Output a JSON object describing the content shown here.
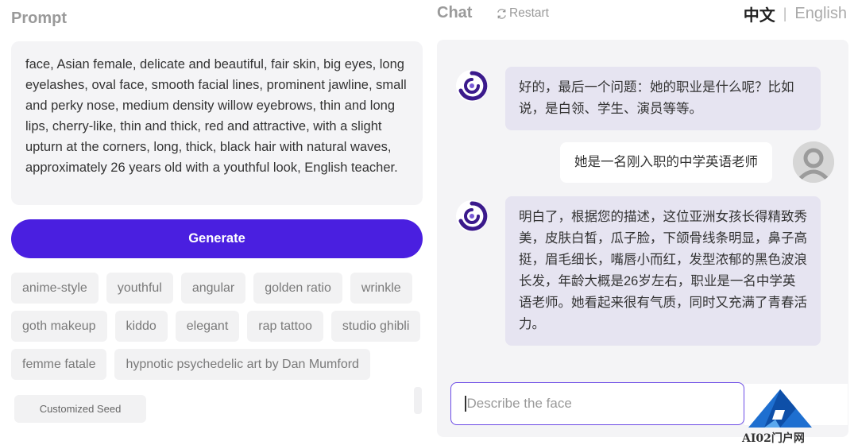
{
  "prompt": {
    "title": "Prompt",
    "text": "face, Asian female, delicate and beautiful, fair skin, big eyes, long eyelashes, oval face, smooth facial lines, prominent jawline, small and perky nose, medium density willow eyebrows, thin and long lips, cherry-like, thin and thick, red and attractive, with a slight upturn at the corners, long, thick, black hair with natural waves, approximately 26 years old with a youthful look, English teacher."
  },
  "generate_label": "Generate",
  "tags": [
    [
      "anime-style",
      "youthful",
      "angular",
      "golden ratio",
      "wrinkle"
    ],
    [
      "goth makeup",
      "kiddo",
      "elegant",
      "rap tattoo",
      "studio ghibli"
    ],
    [
      "femme fatale",
      "hypnotic psychedelic art by Dan Mumford"
    ]
  ],
  "seed_label": "Customized Seed",
  "chat": {
    "title": "Chat",
    "restart_label": "Restart",
    "lang_zh": "中文",
    "lang_sep": "|",
    "lang_en": "English",
    "messages": [
      {
        "role": "bot",
        "text": "好的，最后一个问题：她的职业是什么呢？比如说，是白领、学生、演员等等。"
      },
      {
        "role": "user",
        "text": "她是一名刚入职的中学英语老师"
      },
      {
        "role": "bot",
        "text": "明白了，根据您的描述，这位亚洲女孩长得精致秀美，皮肤白皙，瓜子脸，下颌骨线条明显，鼻子高挺，眉毛细长，嘴唇小而红，发型浓郁的黑色波浪长发，年龄大概是26岁左右，职业是一名中学英语老师。她看起来很有气质，同时又充满了青春活力。"
      }
    ],
    "input_placeholder": "Describe the face"
  },
  "watermark_text": "AI02门户网",
  "colors": {
    "accent": "#4a1fe0",
    "bot_bubble": "#e6e4f1",
    "panel_bg": "#f4f4f6",
    "input_border": "#6c4ce6"
  },
  "icons": {
    "restart": "restart-icon",
    "bot_avatar": "bot-logo-icon",
    "user_avatar": "user-avatar-icon"
  }
}
